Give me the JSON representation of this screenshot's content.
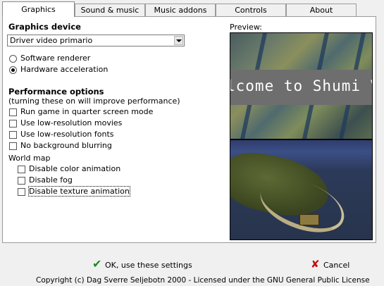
{
  "tabs": [
    "Graphics",
    "Sound & music",
    "Music addons",
    "Controls",
    "About"
  ],
  "graphics_device": {
    "heading": "Graphics device",
    "selected": "Driver video primario",
    "renderers": [
      {
        "label": "Software renderer",
        "selected": false
      },
      {
        "label": "Hardware acceleration",
        "selected": true
      }
    ]
  },
  "performance": {
    "heading": "Performance options",
    "subtitle": "(turning these on will improve performance)",
    "options": [
      {
        "label": "Run game in quarter screen mode",
        "checked": false
      },
      {
        "label": "Use low-resolution movies",
        "checked": false
      },
      {
        "label": "Use low-resolution fonts",
        "checked": false
      },
      {
        "label": "No background blurring",
        "checked": false
      }
    ]
  },
  "world_map": {
    "heading": "World map",
    "options": [
      {
        "label": "Disable color animation",
        "checked": false
      },
      {
        "label": "Disable fog",
        "checked": false
      },
      {
        "label": "Disable texture animation",
        "checked": false
      }
    ]
  },
  "preview": {
    "label": "Preview:",
    "banner_text": "lcome to Shumi V"
  },
  "buttons": {
    "ok_label": "OK, use these settings",
    "cancel_label": "Cancel"
  },
  "footer": "Copyright (c) Dag Sverre Seljebotn 2000   -   Licensed under the GNU General Public License",
  "colors": {
    "ok_icon": "#1e8a1e",
    "cancel_icon": "#c01010"
  }
}
